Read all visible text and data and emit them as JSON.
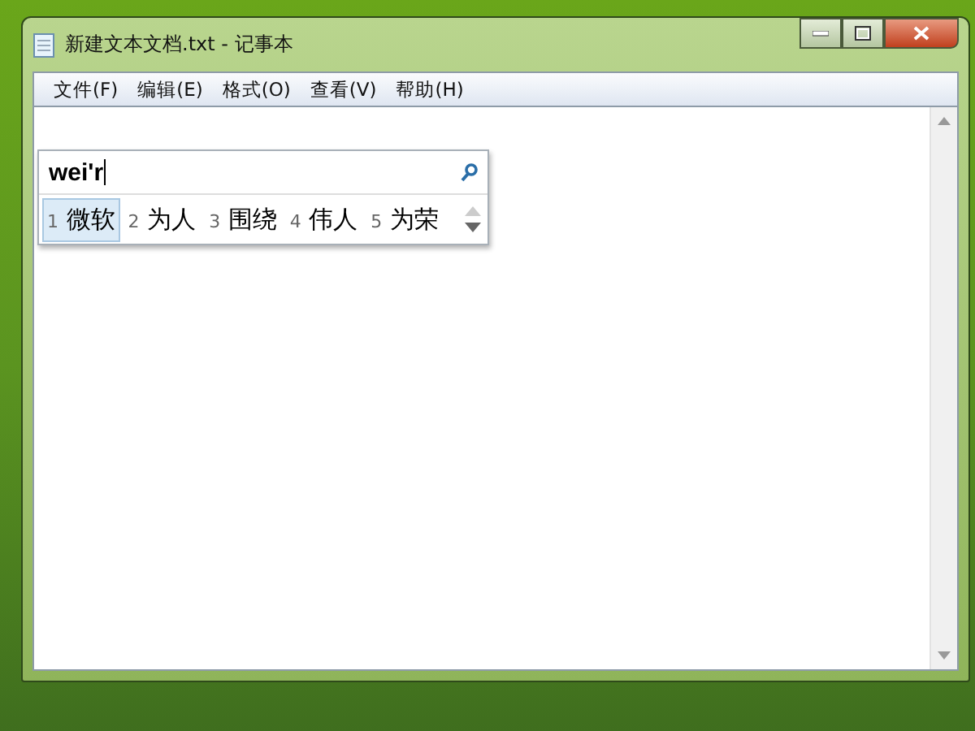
{
  "window": {
    "title": "新建文本文档.txt - 记事本"
  },
  "menu": [
    "文件(F)",
    "编辑(E)",
    "格式(O)",
    "查看(V)",
    "帮助(H)"
  ],
  "ime": {
    "input": "wei'r",
    "candidates": [
      {
        "index": "1",
        "text": "微软",
        "selected": true
      },
      {
        "index": "2",
        "text": "为人",
        "selected": false
      },
      {
        "index": "3",
        "text": "围绕",
        "selected": false
      },
      {
        "index": "4",
        "text": "伟人",
        "selected": false
      },
      {
        "index": "5",
        "text": "为荣",
        "selected": false
      }
    ]
  }
}
